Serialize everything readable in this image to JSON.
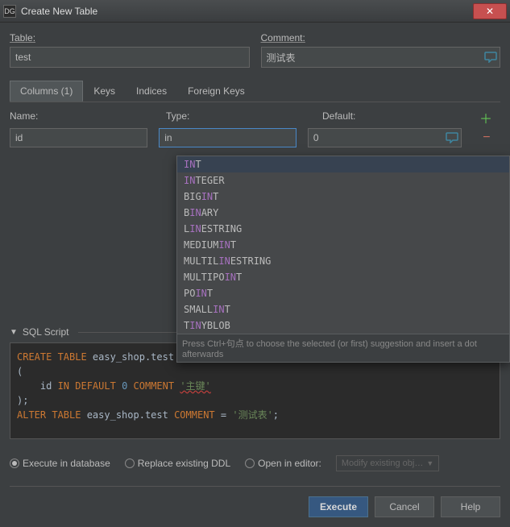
{
  "window": {
    "app_icon_text": "DG",
    "title": "Create New Table",
    "close_glyph": "✕"
  },
  "fields": {
    "table_label": "Table:",
    "table_value": "test",
    "comment_label": "Comment:",
    "comment_value": "测试表"
  },
  "tabs": {
    "columns": "Columns (1)",
    "keys": "Keys",
    "indices": "Indices",
    "foreign_keys": "Foreign Keys"
  },
  "columns": {
    "name_label": "Name:",
    "type_label": "Type:",
    "default_label": "Default:",
    "row": {
      "name": "id",
      "type": "in",
      "default": "0"
    }
  },
  "autocomplete": {
    "items": [
      {
        "pre": "IN",
        "post": "T"
      },
      {
        "pre": "IN",
        "post": "TEGER"
      },
      {
        "pre": "",
        "mid": "BIG",
        "hl": "IN",
        "post": "T"
      },
      {
        "pre": "",
        "mid": "B",
        "hl": "IN",
        "post": "ARY"
      },
      {
        "pre": "",
        "mid": "L",
        "hl": "IN",
        "post": "ESTRING"
      },
      {
        "pre": "",
        "mid": "MEDIUM",
        "hl": "IN",
        "post": "T"
      },
      {
        "pre": "",
        "mid": "MULTIL",
        "hl": "IN",
        "post": "ESTRING"
      },
      {
        "pre": "",
        "mid": "MULTIPO",
        "hl": "IN",
        "post": "T"
      },
      {
        "pre": "",
        "mid": "PO",
        "hl": "IN",
        "post": "T"
      },
      {
        "pre": "",
        "mid": "SMALL",
        "hl": "IN",
        "post": "T"
      },
      {
        "pre": "",
        "mid": "T",
        "hl": "IN",
        "post": "YBLOB"
      }
    ],
    "hint": "Press Ctrl+句点 to choose the selected (or first) suggestion and insert a dot afterwards"
  },
  "sql": {
    "header": "SQL Script",
    "l1_kw": "CREATE TABLE",
    "l1_ident": " easy_shop.test",
    "l2": "(",
    "l3_id": "    id ",
    "l3_in": "IN",
    "l3_def": " DEFAULT ",
    "l3_zero": "0",
    "l3_com": " COMMENT ",
    "l3_str": "'主键'",
    "l4": ");",
    "l5_kw": "ALTER TABLE",
    "l5_ident": " easy_shop.test ",
    "l5_kw2": "COMMENT",
    "l5_eq": " = ",
    "l5_str": "'测试表'",
    "l5_semi": ";"
  },
  "options": {
    "execute_db": "Execute in database",
    "replace_ddl": "Replace existing DDL",
    "open_editor": "Open in editor:",
    "modify_btn": "Modify existing obj…"
  },
  "buttons": {
    "execute": "Execute",
    "cancel": "Cancel",
    "help": "Help"
  }
}
